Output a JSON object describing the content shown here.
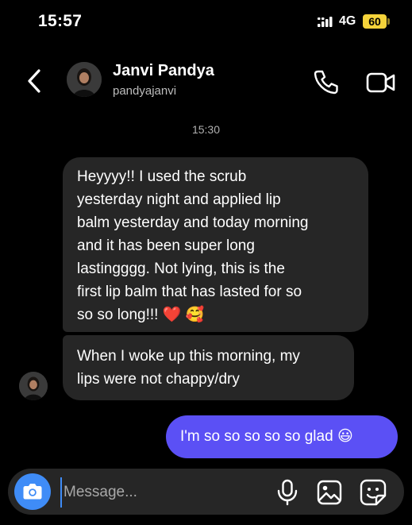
{
  "status_bar": {
    "time": "15:57",
    "network": "4G",
    "battery": "60",
    "battery_color": "#f5d33a"
  },
  "header": {
    "contact_name": "Janvi Pandya",
    "username": "pandyajanvi"
  },
  "chat": {
    "timestamp": "15:30",
    "messages": [
      {
        "direction": "incoming",
        "text": "Heyyyy!! I used the scrub\nyesterday night and applied lip\nbalm yesterday and today morning\nand it has been super long\nlastingggg. Not lying, this is the\nfirst lip balm that has lasted for so\nso so long!!! ❤️ 🥰"
      },
      {
        "direction": "incoming",
        "text": "When I woke up this morning, my\nlips were not chappy/dry"
      },
      {
        "direction": "outgoing",
        "text": "I'm so so so so so glad 😃"
      }
    ],
    "incoming_bubble_color": "#262626",
    "outgoing_bubble_color": "#5b50f5"
  },
  "composer": {
    "placeholder": "Message...",
    "value": "",
    "accent_color": "#3f8cf7",
    "icons": [
      "camera-icon",
      "microphone-icon",
      "gallery-icon",
      "sticker-icon"
    ]
  }
}
